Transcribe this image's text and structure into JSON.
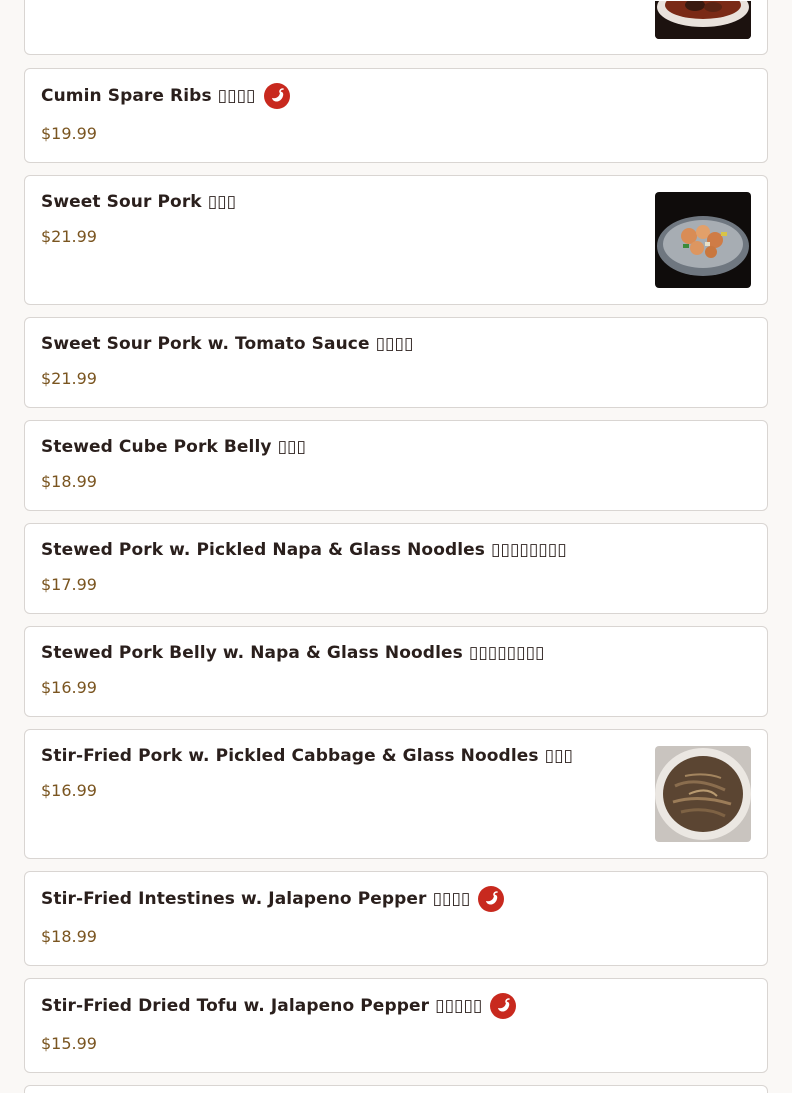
{
  "items": [
    {
      "name": "",
      "price": ""
    },
    {
      "name": "Cumin Spare Ribs ▯▯▯▯",
      "price": "$19.99",
      "spicy": true
    },
    {
      "name": "Sweet Sour Pork ▯▯▯",
      "price": "$21.99",
      "image": "sweet-sour-pork-photo"
    },
    {
      "name": "Sweet Sour Pork w. Tomato Sauce ▯▯▯▯",
      "price": "$21.99"
    },
    {
      "name": "Stewed Cube Pork Belly ▯▯▯",
      "price": "$18.99"
    },
    {
      "name": "Stewed Pork w. Pickled Napa & Glass Noodles ▯▯▯▯▯▯▯▯",
      "price": "$17.99"
    },
    {
      "name": "Stewed Pork Belly w. Napa & Glass Noodles ▯▯▯▯▯▯▯▯",
      "price": "$16.99"
    },
    {
      "name": "Stir-Fried Pork w. Pickled Cabbage & Glass Noodles ▯▯▯",
      "price": "$16.99",
      "image": "stir-fried-pork-cabbage-photo"
    },
    {
      "name": "Stir-Fried Intestines w. Jalapeno Pepper ▯▯▯▯",
      "price": "$18.99",
      "spicy": true
    },
    {
      "name": "Stir-Fried Dried Tofu w. Jalapeno Pepper ▯▯▯▯▯",
      "price": "$15.99",
      "spicy": true
    }
  ],
  "colors": {
    "spicy_badge": "#c8291e",
    "price": "#7a5520",
    "name": "#2a1f1c"
  }
}
